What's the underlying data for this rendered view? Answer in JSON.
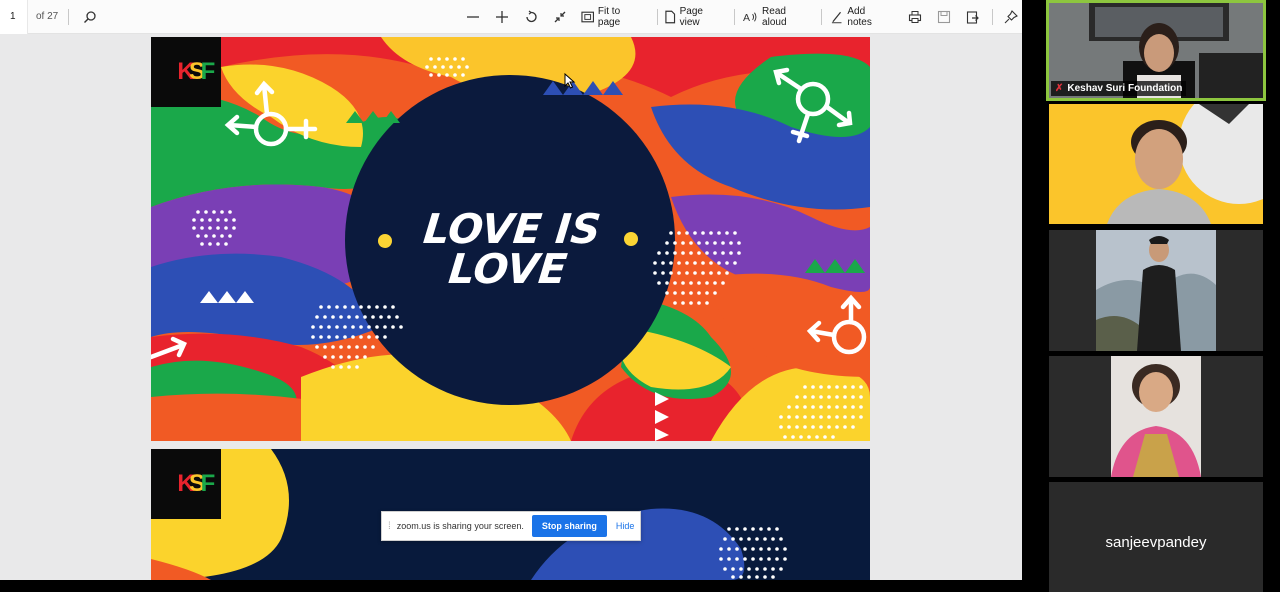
{
  "toolbar": {
    "page_current": "1",
    "page_total": "of 27",
    "fit_label": "Fit to page",
    "page_view_label": "Page view",
    "read_aloud_label": "Read aloud",
    "add_notes_label": "Add notes"
  },
  "slide": {
    "headline_line1": "LOVE IS",
    "headline_line2": "LOVE",
    "logo_text": "KSF"
  },
  "share_banner": {
    "message": "zoom.us is sharing your screen.",
    "stop_label": "Stop sharing",
    "hide_label": "Hide"
  },
  "participants": [
    {
      "name": "Keshav Suri Foundation",
      "muted": true
    },
    {
      "name": ""
    },
    {
      "name": ""
    },
    {
      "name": ""
    },
    {
      "name": "sanjeevpandey"
    }
  ],
  "colors": {
    "accent": "#1a73e8",
    "active_speaker": "#8dc63f",
    "navy": "#0b1a3d"
  }
}
